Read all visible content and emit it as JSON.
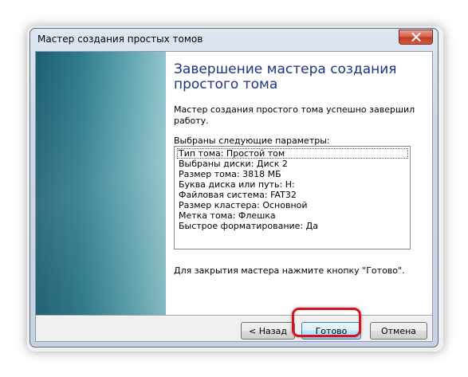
{
  "window": {
    "title": "Мастер создания простых томов"
  },
  "heading": "Завершение мастера создания простого тома",
  "intro": "Мастер создания простого тома успешно завершил работу.",
  "params_label": "Выбраны следующие параметры:",
  "params": [
    "Тип тома: Простой том",
    "Выбраны диски: Диск 2",
    "Размер тома: 3818 МБ",
    "Буква диска или путь: H:",
    "Файловая система: FAT32",
    "Размер кластера: Основной",
    "Метка тома: Флешка",
    "Быстрое форматирование: Да"
  ],
  "close_hint": "Для закрытия мастера нажмите кнопку \"Готово\".",
  "buttons": {
    "back": "< Назад",
    "done": "Готово",
    "cancel": "Отмена"
  },
  "icons": {
    "close": "close-icon"
  },
  "colors": {
    "heading": "#1e3287",
    "highlight": "#d0161c",
    "side_panel": "#2d7a8c"
  }
}
